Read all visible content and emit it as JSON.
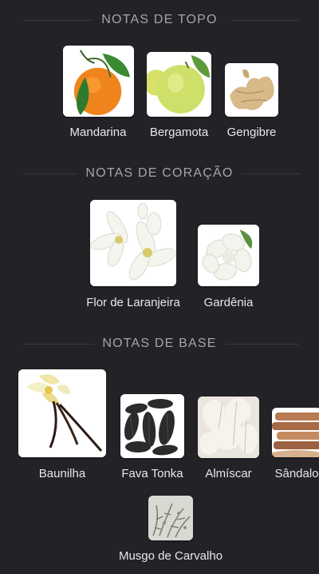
{
  "sections": [
    {
      "title": "NOTAS DE TOPO"
    },
    {
      "title": "NOTAS DE CORAÇÃO"
    },
    {
      "title": "NOTAS DE BASE"
    }
  ],
  "notes": [
    {
      "label": "Mandarina",
      "icon": "mandarin-icon"
    },
    {
      "label": "Bergamota",
      "icon": "bergamot-icon"
    },
    {
      "label": "Gengibre",
      "icon": "ginger-icon"
    },
    {
      "label": "Flor de Laranjeira",
      "icon": "orange-blossom-icon"
    },
    {
      "label": "Gardênia",
      "icon": "gardenia-icon"
    },
    {
      "label": "Baunilha",
      "icon": "vanilla-icon"
    },
    {
      "label": "Fava Tonka",
      "icon": "tonka-bean-icon"
    },
    {
      "label": "Almíscar",
      "icon": "musk-icon"
    },
    {
      "label": "Sândalo",
      "icon": "sandalwood-icon"
    },
    {
      "label": "Musgo de Carvalho",
      "icon": "oakmoss-icon"
    }
  ],
  "colors": {
    "background": "#232227",
    "header_text": "#a5a4ab",
    "label_text": "#e8e8ea"
  }
}
